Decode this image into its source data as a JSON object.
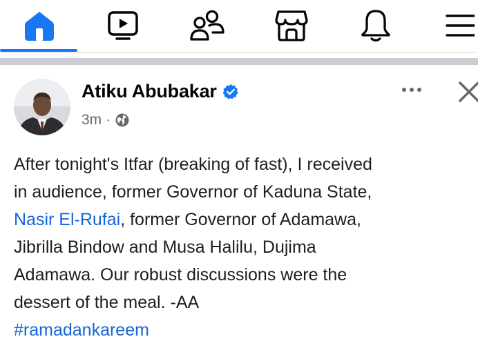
{
  "nav": {
    "items": [
      {
        "icon": "home-icon",
        "active": true
      },
      {
        "icon": "video-icon",
        "active": false
      },
      {
        "icon": "friends-icon",
        "active": false
      },
      {
        "icon": "marketplace-icon",
        "active": false
      },
      {
        "icon": "notifications-icon",
        "active": false
      },
      {
        "icon": "menu-icon",
        "active": false
      }
    ],
    "accent": "#1877f2"
  },
  "post": {
    "author": "Atiku Abubakar",
    "verified": true,
    "time": "3m",
    "separator": "·",
    "audience_icon": "globe-icon",
    "body": {
      "line1": "After tonight's Itfar (breaking of fast), I received",
      "line2": "in audience, former Governor of Kaduna State,",
      "line3_link": "Nasir El-Rufai",
      "line3_rest": ", former Governor of Adamawa,",
      "line4": "Jibrilla Bindow and Musa Halilu, Dujima",
      "line5": "Adamawa. Our robust discussions were the",
      "line6": "dessert of the meal. -AA",
      "hashtag": "#ramadankareem"
    }
  },
  "colors": {
    "link": "#1665d8",
    "secondary_text": "#65676b",
    "verified_badge": "#1877f2"
  }
}
